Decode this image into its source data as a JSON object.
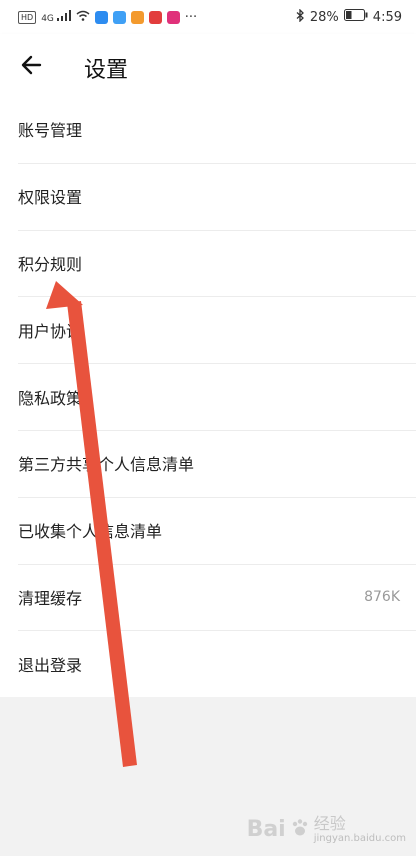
{
  "status_bar": {
    "network_badge": "HD",
    "signal_label": "4G",
    "battery_percent": "28%",
    "time": "4:59",
    "more": "···",
    "app_icon_colors": [
      "#2d8cf0",
      "#3fa0f5",
      "#f39a2e",
      "#e23d3d",
      "#e0317a"
    ]
  },
  "header": {
    "title": "设置",
    "back_icon": "arrow-left-icon"
  },
  "settings": {
    "items": [
      {
        "label": "账号管理",
        "value": ""
      },
      {
        "label": "权限设置",
        "value": ""
      },
      {
        "label": "积分规则",
        "value": ""
      },
      {
        "label": "用户协议",
        "value": ""
      },
      {
        "label": "隐私政策",
        "value": ""
      },
      {
        "label": "第三方共享个人信息清单",
        "value": ""
      },
      {
        "label": "已收集个人信息清单",
        "value": ""
      },
      {
        "label": "清理缓存",
        "value": "876K"
      },
      {
        "label": "退出登录",
        "value": ""
      }
    ]
  },
  "overlay": {
    "arrow_color": "#e8533d",
    "watermark_main": "Bai",
    "watermark_suffix": "经验",
    "watermark_url": "jingyan.baidu.com"
  }
}
